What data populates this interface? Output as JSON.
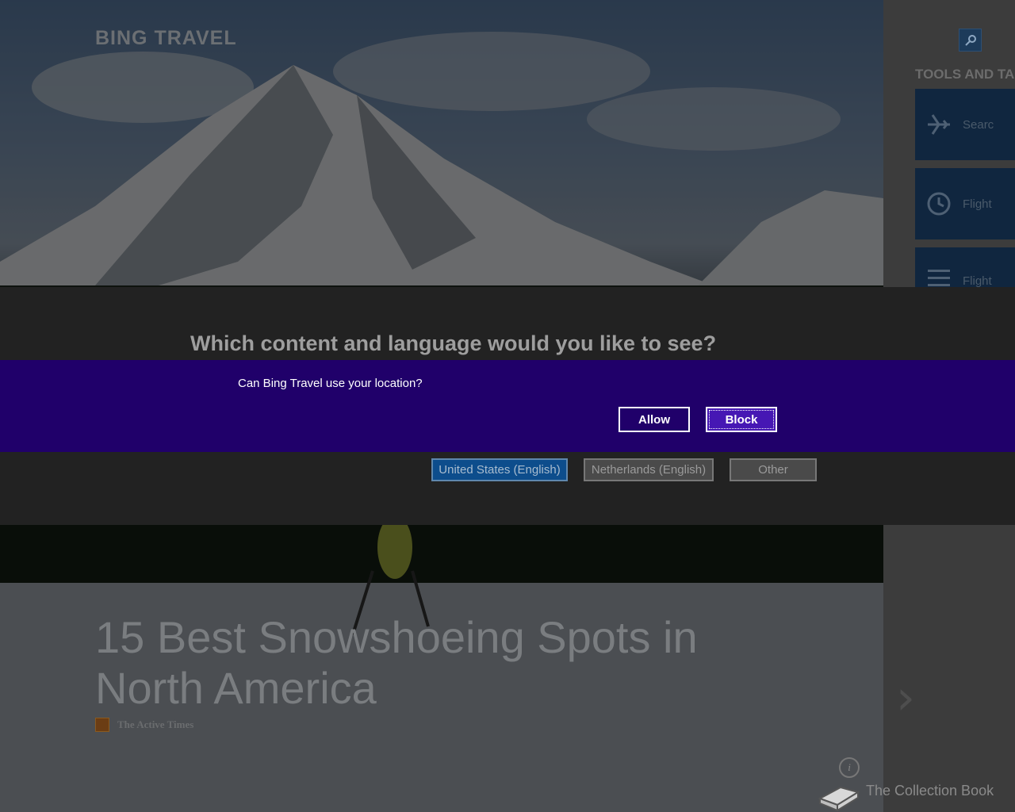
{
  "app": {
    "brand": "BING TRAVEL"
  },
  "hero": {
    "headline": "15 Best Snowshoeing Spots in North America",
    "source": "The Active Times"
  },
  "rail": {
    "search_icon": "search-icon",
    "section_title": "TOOLS AND TA",
    "tiles": [
      {
        "icon": "airplane-icon",
        "label": "Searc"
      },
      {
        "icon": "clock-icon",
        "label": "Flight"
      },
      {
        "icon": "list-icon",
        "label": "Flight"
      }
    ],
    "collection_label": "The Collection Book"
  },
  "language_dialog": {
    "title": "Which content and language would you like to see?",
    "options": [
      {
        "label": "United States (English)",
        "selected": true
      },
      {
        "label": "Netherlands (English)",
        "selected": false
      },
      {
        "label": "Other",
        "selected": false
      }
    ]
  },
  "location_prompt": {
    "question": "Can Bing Travel use your location?",
    "allow_label": "Allow",
    "block_label": "Block"
  },
  "colors": {
    "location_bar": "#20006a",
    "block_button": "#4617b4",
    "selected_language": "#0d4d8c",
    "tile_background": "#10263f"
  }
}
